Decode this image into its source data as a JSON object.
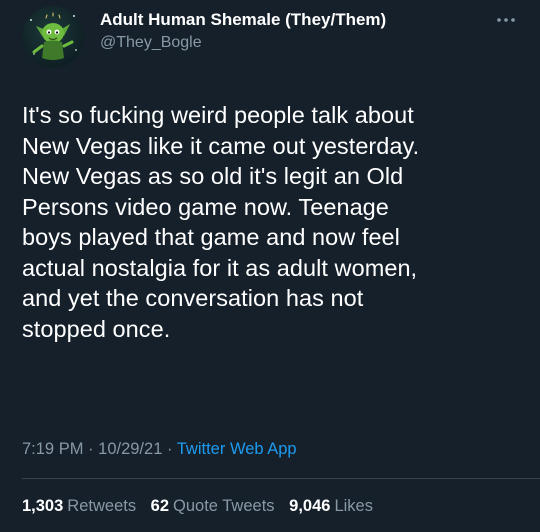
{
  "header": {
    "display_name": "Adult Human Shemale (They/Them)",
    "handle": "@They_Bogle"
  },
  "tweet": {
    "lines": [
      "It's so fucking weird people talk about",
      "New Vegas like it came out yesterday.",
      "New Vegas as so old it's legit an Old",
      "Persons video game now. Teenage",
      "boys played that game and now feel",
      "actual nostalgia for it as adult women,",
      "and yet the conversation has not",
      "stopped once."
    ]
  },
  "meta": {
    "time": "7:19 PM",
    "separator": "·",
    "date": "10/29/21",
    "source": "Twitter Web App"
  },
  "stats": {
    "retweets": {
      "count": "1,303",
      "label": "Retweets"
    },
    "quote_tweets": {
      "count": "62",
      "label": "Quote Tweets"
    },
    "likes": {
      "count": "9,046",
      "label": "Likes"
    }
  },
  "colors": {
    "background": "#15202b",
    "secondary_text": "#8899a6",
    "link": "#1d9bf0",
    "divider": "#38444d"
  },
  "icons": {
    "avatar": "green-goblin-character-avatar",
    "more": "more-options-icon"
  }
}
